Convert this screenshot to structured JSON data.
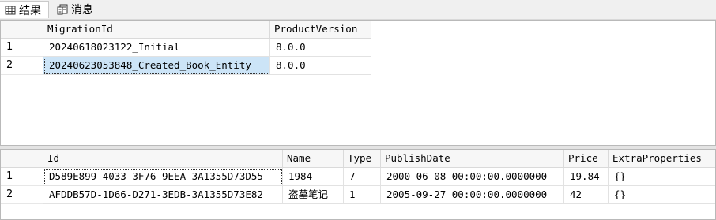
{
  "tabs": {
    "results_label": "结果",
    "messages_label": "消息"
  },
  "grid1": {
    "columns": [
      "MigrationId",
      "ProductVersion"
    ],
    "rows": [
      {
        "num": "1",
        "cells": [
          "20240618023122_Initial",
          "8.0.0"
        ]
      },
      {
        "num": "2",
        "cells": [
          "20240623053848_Created_Book_Entity",
          "8.0.0"
        ]
      }
    ]
  },
  "grid2": {
    "columns": [
      "Id",
      "Name",
      "Type",
      "PublishDate",
      "Price",
      "ExtraProperties"
    ],
    "rows": [
      {
        "num": "1",
        "cells": [
          "D589E899-4033-3F76-9EEA-3A1355D73D55",
          "1984",
          "7",
          "2000-06-08 00:00:00.0000000",
          "19.84",
          "{}"
        ]
      },
      {
        "num": "2",
        "cells": [
          "AFDDB57D-1D66-D271-3EDB-3A1355D73E82",
          "盗墓笔记",
          "1",
          "2005-09-27 00:00:00.0000000",
          "42",
          "{}"
        ]
      }
    ]
  },
  "colors": {
    "selection": "#cce4f7",
    "grid_line": "#e2e2e2",
    "header_bg": "#f7f7f7"
  }
}
